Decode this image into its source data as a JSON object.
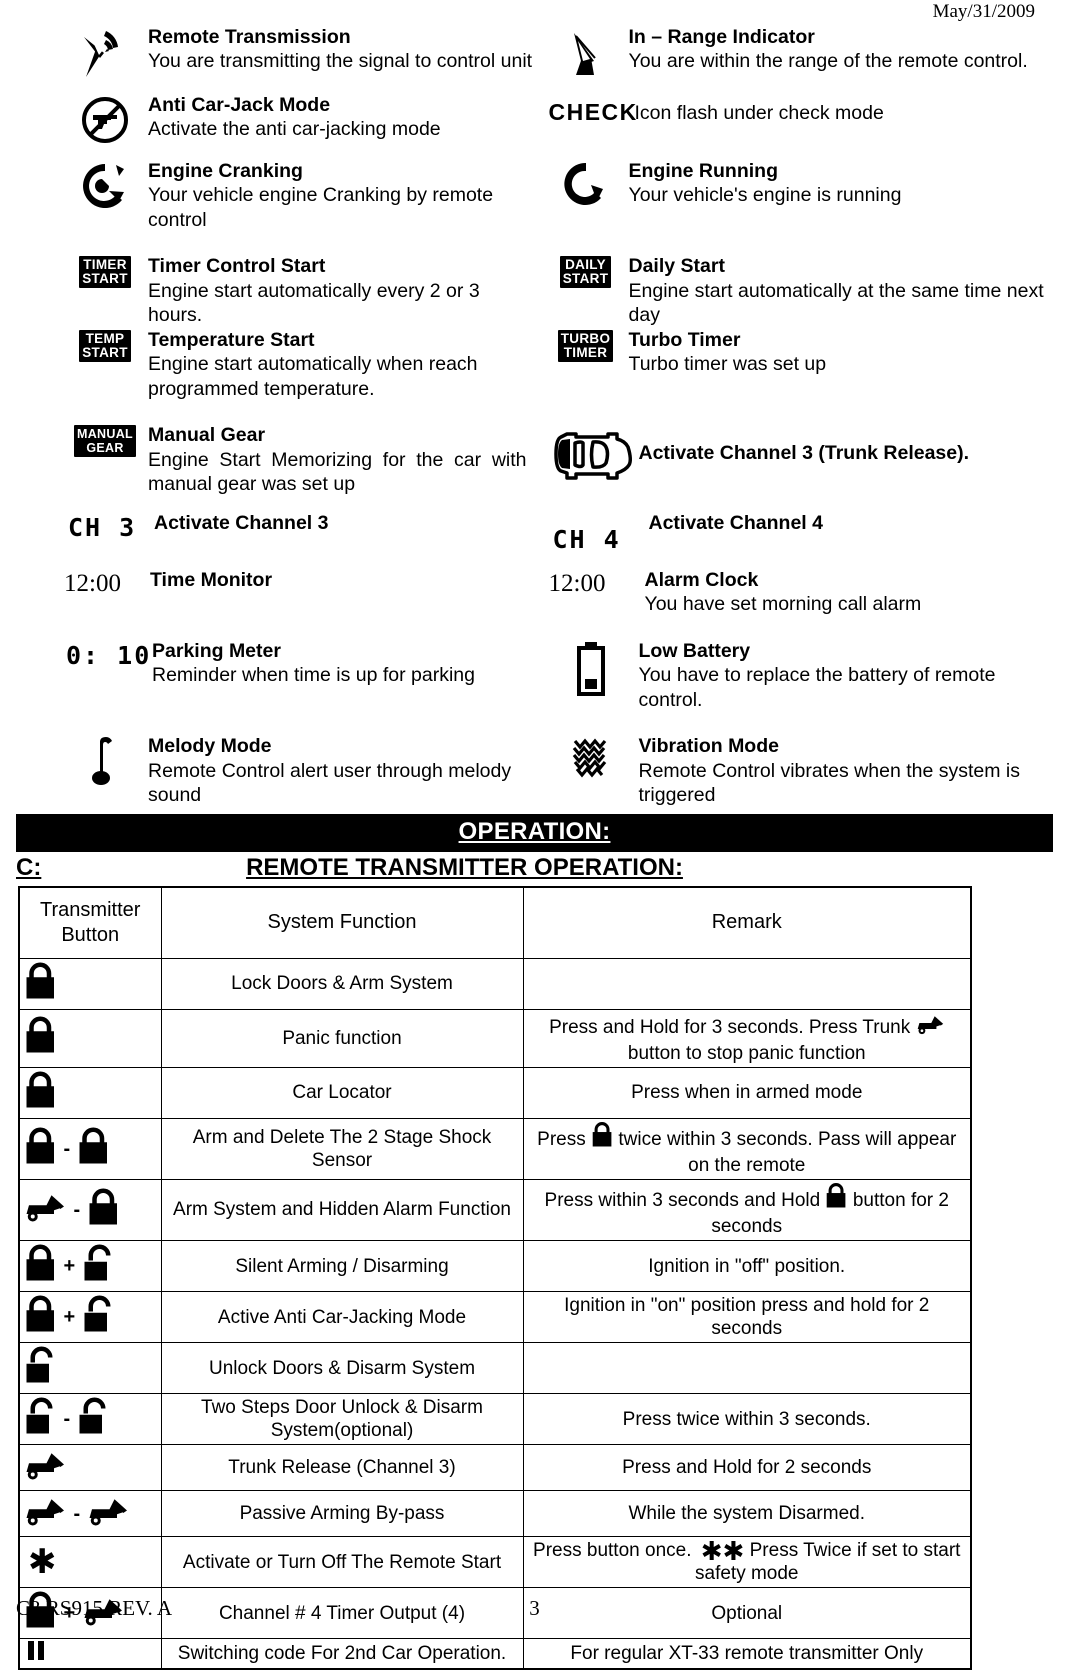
{
  "document": {
    "date": "May/31/2009",
    "footer_left": "C3 RS915 REV. A",
    "page_number": "3"
  },
  "legend": {
    "rows": [
      {
        "left": {
          "icon": "satellite-transmit-icon",
          "title": "Remote Transmission",
          "desc": "You are transmitting the signal to control unit"
        },
        "right": {
          "icon": "satellite-dish-icon",
          "title": "In – Range Indicator",
          "desc": "You are within the range of the remote control."
        }
      },
      {
        "left": {
          "icon": "no-gun-anti-carjack-icon",
          "title": "Anti Car-Jack Mode",
          "desc": "Activate the anti car-jacking mode"
        },
        "right": {
          "icon": "check-word-icon",
          "icon_text": "CHECK",
          "title": "",
          "desc": "Icon flash under check mode"
        }
      },
      {
        "left": {
          "icon": "engine-cranking-icon",
          "title": "Engine Cranking",
          "desc": "Your vehicle engine Cranking by remote control"
        },
        "right": {
          "icon": "engine-running-icon",
          "title": "Engine Running",
          "desc": "Your vehicle's engine is running"
        }
      },
      {
        "left": {
          "icon": "timer-start-badge-icon",
          "badge_line1": "TIMER",
          "badge_line2": "START",
          "title": "Timer Control Start",
          "desc": "Engine start automatically every 2 or 3 hours."
        },
        "right": {
          "icon": "daily-start-badge-icon",
          "badge_line1": "DAILY",
          "badge_line2": "START",
          "title": "Daily Start",
          "desc": "Engine start automatically at the same time next day"
        }
      },
      {
        "left": {
          "icon": "temp-start-badge-icon",
          "badge_line1": "TEMP",
          "badge_line2": "START",
          "title": "Temperature Start",
          "desc": "Engine start automatically when reach programmed temperature."
        },
        "right": {
          "icon": "turbo-timer-badge-icon",
          "badge_line1": "TURBO",
          "badge_line2": "TIMER",
          "title": "Turbo Timer",
          "desc": "Turbo timer was set up"
        }
      },
      {
        "left": {
          "icon": "manual-gear-badge-icon",
          "badge_line1": "MANUAL",
          "badge_line2": "GEAR",
          "title": "Manual Gear",
          "desc": "Engine Start Memorizing for the car with manual gear was set up"
        },
        "right": {
          "icon": "car-trunk-open-icon",
          "title": "Activate Channel 3 (Trunk Release).",
          "desc": ""
        }
      },
      {
        "left": {
          "icon": "lcd-ch3-icon",
          "icon_text": "CH 3",
          "title": "Activate Channel 3",
          "desc": ""
        },
        "right": {
          "icon": "lcd-ch4-icon",
          "icon_text": "CH 4",
          "title": "Activate Channel 4",
          "desc": ""
        }
      },
      {
        "left": {
          "icon": "clock-time-icon",
          "icon_text": "12:00",
          "title": "Time Monitor",
          "desc": ""
        },
        "right": {
          "icon": "alarm-clock-time-icon",
          "icon_text": "12:00",
          "title": "Alarm Clock",
          "desc": "You have set morning call alarm"
        }
      },
      {
        "left": {
          "icon": "parking-meter-lcd-icon",
          "icon_text": "0: 10",
          "title": "Parking Meter",
          "desc": "Reminder when time is up for parking"
        },
        "right": {
          "icon": "low-battery-icon",
          "title": "Low Battery",
          "desc": "You have to replace the battery of remote control."
        }
      },
      {
        "left": {
          "icon": "music-note-icon",
          "title": "Melody Mode",
          "desc": "Remote Control alert user through melody sound"
        },
        "right": {
          "icon": "vibration-waves-icon",
          "title": "Vibration Mode",
          "desc": "Remote Control vibrates when the system is triggered"
        }
      }
    ]
  },
  "operation": {
    "bar_title": "OPERATION:",
    "section_letter": "C:",
    "section_title": "REMOTE TRANSMITTER OPERATION:"
  },
  "table": {
    "headers": {
      "button": "Transmitter Button",
      "function": "System Function",
      "remark": "Remark"
    },
    "rows": [
      {
        "buttons": [
          {
            "icon": "lock-closed-icon"
          }
        ],
        "function": "Lock Doors & Arm System",
        "remark_parts": [
          {
            "type": "text",
            "value": ""
          }
        ]
      },
      {
        "buttons": [
          {
            "icon": "lock-closed-icon"
          }
        ],
        "function": "Panic function",
        "remark_parts": [
          {
            "type": "text",
            "value": "Press and Hold for 3 seconds. Press Trunk "
          },
          {
            "type": "icon",
            "icon": "trunk-release-icon"
          },
          {
            "type": "text",
            "value": " button to stop panic function"
          }
        ]
      },
      {
        "buttons": [
          {
            "icon": "lock-closed-icon"
          }
        ],
        "function": "Car Locator",
        "remark_parts": [
          {
            "type": "text",
            "value": "Press when in armed mode"
          }
        ]
      },
      {
        "buttons": [
          {
            "icon": "lock-closed-icon"
          },
          {
            "sep": "-"
          },
          {
            "icon": "lock-closed-icon"
          }
        ],
        "function": "Arm and Delete The 2 Stage Shock Sensor",
        "remark_parts": [
          {
            "type": "text",
            "value": "Press "
          },
          {
            "type": "icon",
            "icon": "lock-closed-icon"
          },
          {
            "type": "text",
            "value": " twice within 3 seconds. Pass will appear on the remote"
          }
        ]
      },
      {
        "buttons": [
          {
            "icon": "trunk-release-icon"
          },
          {
            "sep": "-"
          },
          {
            "icon": "lock-closed-icon"
          }
        ],
        "function": "Arm System and Hidden Alarm Function",
        "remark_parts": [
          {
            "type": "text",
            "value": "Press within 3 seconds and Hold "
          },
          {
            "type": "icon",
            "icon": "lock-closed-icon"
          },
          {
            "type": "text",
            "value": " button for 2 seconds"
          }
        ]
      },
      {
        "buttons": [
          {
            "icon": "lock-closed-icon"
          },
          {
            "sep": "+"
          },
          {
            "icon": "lock-open-icon"
          }
        ],
        "function": "Silent Arming / Disarming",
        "remark_parts": [
          {
            "type": "text",
            "value": "Ignition in \"off\" position."
          }
        ]
      },
      {
        "buttons": [
          {
            "icon": "lock-closed-icon"
          },
          {
            "sep": "+"
          },
          {
            "icon": "lock-open-icon"
          }
        ],
        "function": "Active Anti Car-Jacking Mode",
        "remark_parts": [
          {
            "type": "text",
            "value": "Ignition in \"on\" position press and hold for 2 seconds"
          }
        ]
      },
      {
        "buttons": [
          {
            "icon": "lock-open-icon"
          }
        ],
        "function": "Unlock Doors & Disarm System",
        "remark_parts": [
          {
            "type": "text",
            "value": ""
          }
        ]
      },
      {
        "buttons": [
          {
            "icon": "lock-open-icon"
          },
          {
            "sep": "-"
          },
          {
            "icon": "lock-open-icon"
          }
        ],
        "function": "Two Steps Door Unlock & Disarm System(optional)",
        "remark_parts": [
          {
            "type": "text",
            "value": "Press twice within 3 seconds."
          }
        ]
      },
      {
        "buttons": [
          {
            "icon": "trunk-release-icon"
          }
        ],
        "function": "Trunk Release (Channel 3)",
        "remark_parts": [
          {
            "type": "text",
            "value": "Press and Hold for 2 seconds"
          }
        ]
      },
      {
        "buttons": [
          {
            "icon": "trunk-release-icon"
          },
          {
            "sep": "-"
          },
          {
            "icon": "trunk-release-icon"
          }
        ],
        "function": "Passive Arming By-pass",
        "remark_parts": [
          {
            "type": "text",
            "value": "While the system Disarmed."
          }
        ]
      },
      {
        "buttons": [
          {
            "icon": "asterisk-star-icon"
          }
        ],
        "function": "Activate or Turn Off The Remote Start",
        "remark_parts": [
          {
            "type": "text",
            "value": "Press button once. "
          },
          {
            "type": "icon",
            "icon": "double-asterisk-icon"
          },
          {
            "type": "text",
            "value": " Press Twice if set to start safety mode"
          }
        ]
      },
      {
        "buttons": [
          {
            "icon": "lock-closed-icon"
          },
          {
            "sep": "+"
          },
          {
            "icon": "trunk-release-icon"
          }
        ],
        "function": "Channel # 4 Timer Output (4)",
        "remark_parts": [
          {
            "type": "text",
            "value": "Optional"
          }
        ]
      },
      {
        "buttons": [
          {
            "icon": "pause-bars-icon"
          }
        ],
        "function": "Switching code For 2nd Car Operation.",
        "remark_parts": [
          {
            "type": "text",
            "value": "For regular XT-33 remote transmitter Only"
          }
        ]
      }
    ]
  },
  "colors": {
    "ink": "#000000",
    "paper": "#ffffff"
  }
}
